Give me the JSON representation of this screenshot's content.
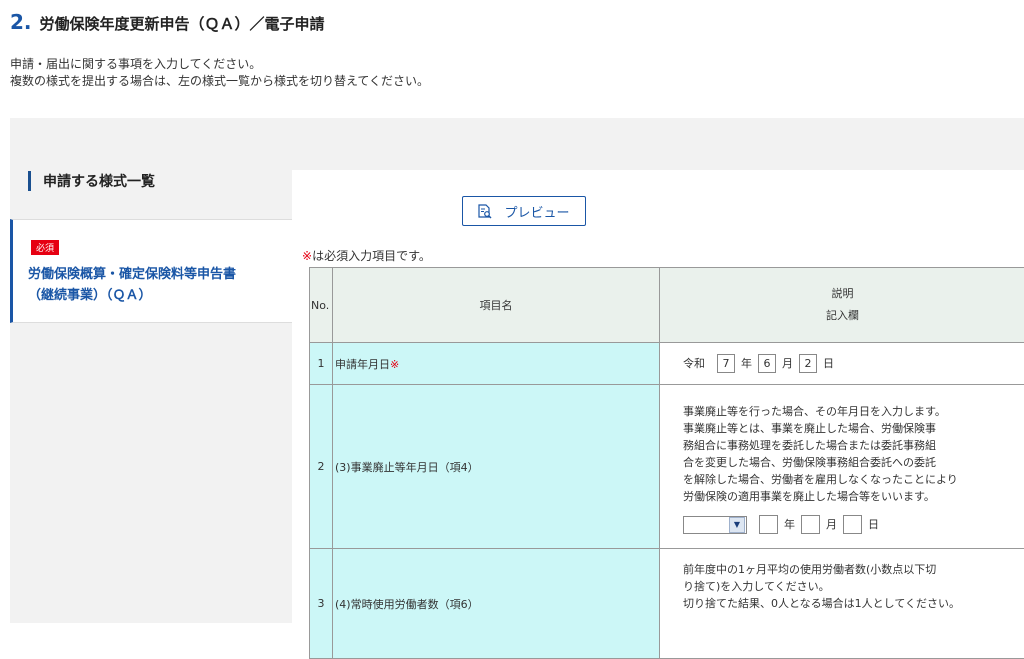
{
  "header": {
    "section_number": "2.",
    "title": "労働保険年度更新申告（ＱＡ）／電子申請",
    "description": [
      "申請・届出に関する事項を入力してください。",
      "複数の様式を提出する場合は、左の様式一覧から様式を切り替えてください。"
    ]
  },
  "sidebar": {
    "heading": "申請する様式一覧",
    "items": [
      {
        "badge": "必須",
        "name_line1": "労働保険概算・確定保険料等申告書",
        "name_line2": "（継続事業）（ＱＡ）"
      }
    ]
  },
  "content": {
    "preview_label": "プレビュー",
    "required_note_mark": "※",
    "required_note_text": "は必須入力項目です。",
    "table": {
      "headers": {
        "no": "No.",
        "item": "項目名",
        "desc_line1": "説明",
        "desc_line2": "記入欄"
      },
      "rows": [
        {
          "no": "1",
          "name": "申請年月日",
          "required_mark": "※",
          "era": "令和",
          "year": "7",
          "year_unit": "年",
          "month": "6",
          "month_unit": "月",
          "day": "2",
          "day_unit": "日"
        },
        {
          "no": "2",
          "name": "(3)事業廃止等年月日（項4）",
          "description": [
            "事業廃止等を行った場合、その年月日を入力します。",
            "事業廃止等とは、事業を廃止した場合、労働保険事",
            "務組合に事務処理を委託した場合または委託事務組",
            "合を変更した場合、労働保険事務組合委託への委託",
            "を解除した場合、労働者を雇用しなくなったことにより",
            "労働保険の適用事業を廃止した場合等をいいます。"
          ],
          "era_value": "",
          "year_unit": "年",
          "month_unit": "月",
          "day_unit": "日"
        },
        {
          "no": "3",
          "name": "(4)常時使用労働者数（項6）",
          "description": [
            "前年度中の1ヶ月平均の使用労働者数(小数点以下切",
            "り捨て)を入力してください。",
            "切り捨てた結果、0人となる場合は1人としてください。"
          ]
        }
      ]
    }
  },
  "colors": {
    "accent": "#1a56a6",
    "required": "#e60012",
    "row_bg": "#ccf7f7",
    "header_bg": "#eaf1ec"
  }
}
